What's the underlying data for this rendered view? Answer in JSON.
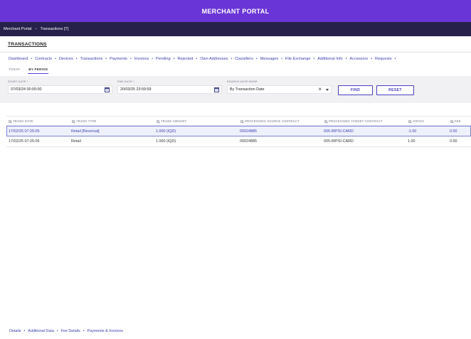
{
  "app": {
    "title": "MERCHANT PORTAL"
  },
  "breadcrumb": [
    "Merchant Portal",
    "Transactions [T]"
  ],
  "page": {
    "section_title": "TRANSACTIONS"
  },
  "nav": [
    "Dashboard",
    "Contracts",
    "Devices",
    "Transactions",
    "Payments",
    "Invoices",
    "Pending",
    "Rejected",
    "Own Addresses",
    "Classifiers",
    "Messages",
    "File Exchange",
    "Additional Info",
    "Accessors",
    "Requests"
  ],
  "period_tabs": [
    {
      "label": "TODAY",
      "active": false
    },
    {
      "label": "BY PERIOD",
      "active": true
    }
  ],
  "filters": {
    "start_date": {
      "label": "START DATE *",
      "value": "07/03/24 00:00:00"
    },
    "end_date": {
      "label": "END DATE *",
      "value": "20/03/25 23:59:59"
    },
    "search_mode": {
      "label": "SEARCH DATE MODE",
      "value": "By Transaction Date"
    },
    "find_label": "FIND",
    "reset_label": "RESET"
  },
  "table": {
    "columns": [
      "TRANS DATE",
      "TRANS TYPE",
      "TRANS AMOUNT",
      "PROCESSING SOURCE CONTRACT",
      "PROCESSING TARGET CONTRACT",
      "GROSS",
      "FEE"
    ],
    "rows": [
      {
        "selected": true,
        "cells": [
          "17/02/25 07:25:05",
          "Retail [Reversal]",
          "1.000 (IQD)",
          "00024885",
          "005-IRPSI-CARD",
          "-1.00",
          "0.00"
        ]
      },
      {
        "selected": false,
        "cells": [
          "17/02/25 07:25:05",
          "Retail",
          "1.000 (IQD)",
          "00024885",
          "005-IRPSI-CARD",
          "1.00",
          "0.00"
        ]
      }
    ]
  },
  "footer_links": [
    "Details",
    "Additional Data",
    "Fee Details",
    "Payments & Invoices"
  ],
  "colors": {
    "header": "#6a35d6",
    "breadcrumb_bar": "#25214a",
    "link": "#3a3fb0",
    "selected_row": "#eef1fb"
  },
  "icons": {
    "calendar": "calendar-icon",
    "clear": "close-icon",
    "dropdown": "chevron-down-icon",
    "column_search": "search-icon"
  }
}
